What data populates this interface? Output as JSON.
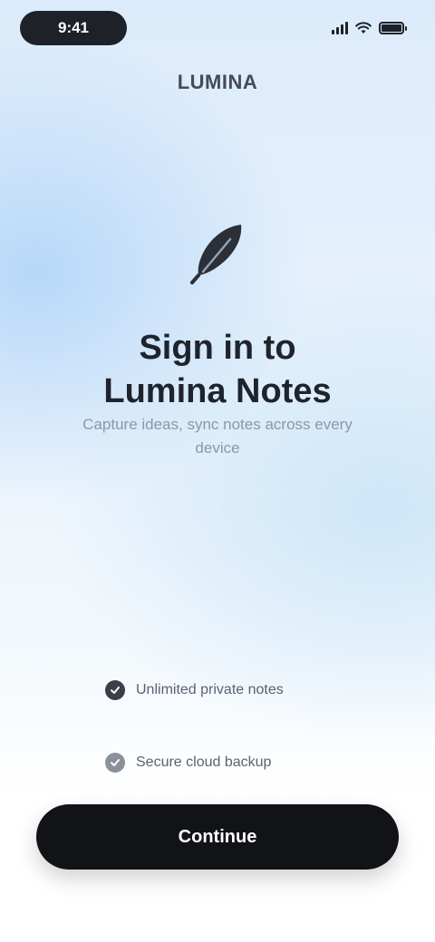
{
  "status_bar": {
    "time": "9:41",
    "icons": [
      "signal-icon",
      "wifi-icon",
      "battery-icon"
    ]
  },
  "header": {
    "label": "LUMINA"
  },
  "hero": {
    "icon": "feather-pen-icon",
    "title": "Sign in to\nLumina Notes",
    "subtitle": "Capture ideas, sync notes across every device"
  },
  "checklist": [
    {
      "icon": "check-icon",
      "label": "Unlimited private notes"
    },
    {
      "icon": "check-icon",
      "label": "Secure cloud backup"
    }
  ],
  "cta": {
    "label": "Continue"
  },
  "footer": {
    "note": ""
  },
  "colors": {
    "accent": "#121317",
    "background_top": "#dcebfb",
    "background_bottom": "#ffffff",
    "title": "#1f232b",
    "muted": "#8d97a6"
  }
}
